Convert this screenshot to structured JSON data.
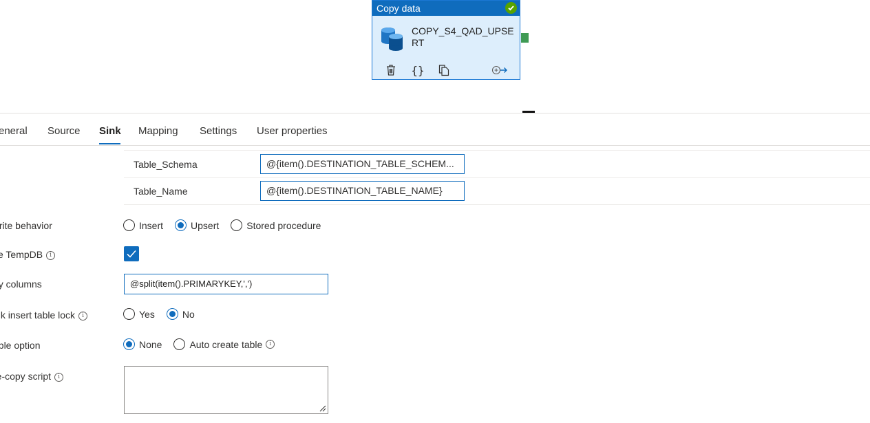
{
  "activity": {
    "type_label": "Copy data",
    "name": "COPY_S4_QAD_UPSERT",
    "status_icon": "check-circle-icon",
    "actions": [
      "delete-icon",
      "code-icon",
      "clone-icon",
      "add-output-icon"
    ]
  },
  "tabs": [
    {
      "label": "General",
      "display": "eneral"
    },
    {
      "label": "Source",
      "display": "Source"
    },
    {
      "label": "Sink",
      "display": "Sink",
      "active": true
    },
    {
      "label": "Mapping",
      "display": "Mapping"
    },
    {
      "label": "Settings",
      "display": "Settings"
    },
    {
      "label": "User properties",
      "display": "User properties"
    }
  ],
  "sink": {
    "params": [
      {
        "name": "Table_Schema",
        "value": "@{item().DESTINATION_TABLE_SCHEM..."
      },
      {
        "name": "Table_Name",
        "value": "@{item().DESTINATION_TABLE_NAME}"
      }
    ],
    "write_behavior": {
      "label": "Write behavior",
      "display_label": "Vrite behavior",
      "options": [
        "Insert",
        "Upsert",
        "Stored procedure"
      ],
      "selected": "Upsert"
    },
    "use_tempdb": {
      "label": "Use TempDB",
      "display_label": "se TempDB",
      "checked": true
    },
    "key_columns": {
      "label": "Key columns",
      "display_label": "ey columns",
      "value": "@split(item().PRIMARYKEY,',')"
    },
    "bulk_insert_lock": {
      "label": "Bulk insert table lock",
      "display_label": "ulk insert table lock",
      "options": [
        "Yes",
        "No"
      ],
      "selected": "No"
    },
    "table_option": {
      "label": "Table option",
      "display_label": "able option",
      "options": [
        "None",
        "Auto create table"
      ],
      "selected": "None"
    },
    "pre_copy_script": {
      "label": "Pre-copy script",
      "display_label": "re-copy script",
      "value": ""
    }
  },
  "colors": {
    "accent": "#0f6cbd",
    "node_bg": "#ddeefc",
    "success": "#57a300",
    "port": "#3f9a54"
  }
}
